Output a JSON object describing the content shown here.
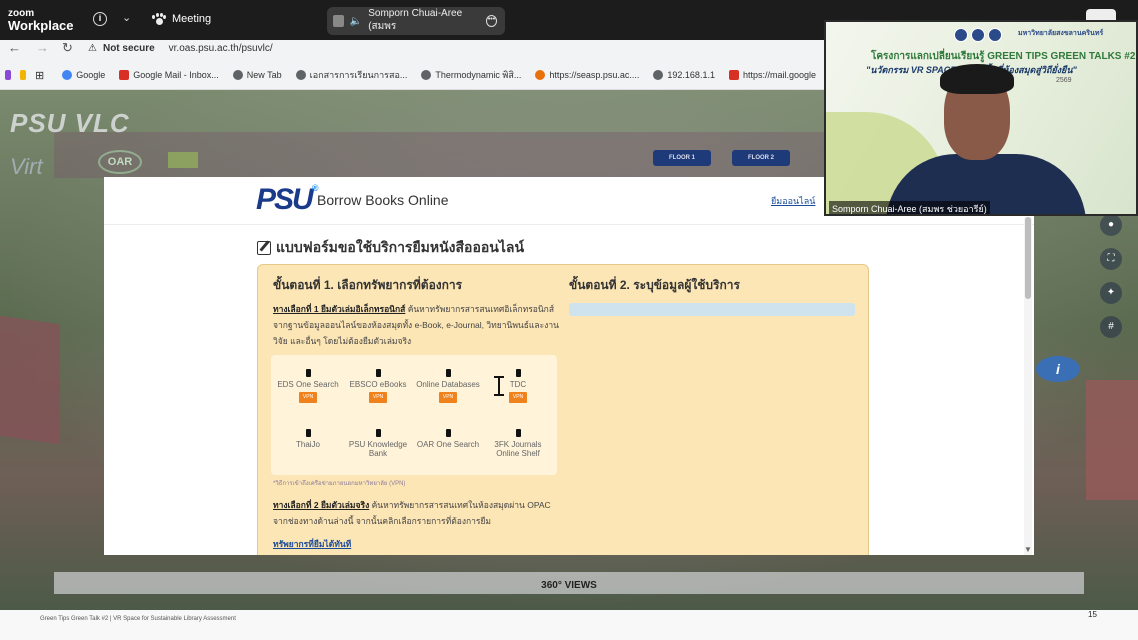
{
  "zoom": {
    "brand_line1": "zoom",
    "brand_line2": "Workplace",
    "meeting_label": "Meeting",
    "speaker": "Somporn Chuai-Aree (สมพร"
  },
  "browser": {
    "security": "Not secure",
    "url": "vr.oas.psu.ac.th/psuvlc/",
    "bookmarks": [
      "Google",
      "Google Mail - Inbox...",
      "New Tab",
      "เอกสารการเรียนการสอ...",
      "Thermodynamic พิสิ...",
      "https://seasp.psu.ac....",
      "192.168.1.1",
      "https://mail.google"
    ]
  },
  "vr": {
    "title": "PSU VLC",
    "subtitle": "Virt",
    "oar_label": "OAR",
    "floors": [
      "FLOOR 1",
      "FLOOR 2"
    ],
    "views_label": "360° VIEWS"
  },
  "modal": {
    "logo": "PSU",
    "logo_mark": "®",
    "title": "Borrow Books Online",
    "header_link": "ยืมออนไลน์",
    "form_title": "แบบฟอร์มขอใช้บริการยืมหนังสือออนไลน์",
    "step1": "ขั้นตอนที่ 1. เลือกทรัพยากรที่ต้องการ",
    "step2": "ขั้นตอนที่ 2. ระบุข้อมูลผู้ใช้บริการ",
    "option1_head": "ทางเลือกที่ 1 ยืมตัวเล่มอิเล็กทรอนิกส์",
    "option1_body": " ค้นหาทรัพยากรสารสนเทศอิเล็กทรอนิกส์จากฐานข้อมูลออนไลน์ของห้องสมุดทั้ง e-Book, e-Journal, วิทยานิพนธ์และงานวิจัย และอื่นๆ โดยไม่ต้องยืมตัวเล่มจริง",
    "resources": [
      {
        "name": "EDS One Search",
        "vpn": "VPN"
      },
      {
        "name": "EBSCO eBooks",
        "vpn": "VPN"
      },
      {
        "name": "Online Databases",
        "vpn": "VPN"
      },
      {
        "name": "TDC",
        "vpn": "VPN"
      },
      {
        "name": "ThaiJo",
        "vpn": ""
      },
      {
        "name": "PSU Knowledge Bank",
        "vpn": ""
      },
      {
        "name": "OAR One Search",
        "vpn": ""
      },
      {
        "name": "3FK Journals Online Shelf",
        "vpn": ""
      }
    ],
    "vpn_note": "*วิธีการเข้าถึงเครือข่ายภายนอกมหาวิทยาลัย (VPN)",
    "option2_head": "ทางเลือกที่ 2 ยืมตัวเล่มจริง",
    "option2_body": " ค้นหาทรัพยากรสารสนเทศในห้องสมุดผ่าน OPAC จากช่องทางด้านล่างนี้ จากนั้นคลิกเลือกรายการที่ต้องการยืม",
    "available_now": "ทรัพยากรที่ยืมได้ทันที"
  },
  "video": {
    "project_line": "โครงการแลกเปลี่ยนเรียนรู้ GREEN TIPS GREEN TALKS #2",
    "topic_line": "\"นวัตกรรม VR SPACE: ...เมินพื้นที่ห้องสมุดสู่วิถียั่งยืน\"",
    "year": "2569",
    "uni": "มหาวิทยาลัยสงขลานครินทร์",
    "name_tag": "Somporn Chuai-Aree (สมพร ช่วยอารีย์)"
  },
  "footer": {
    "text": "Green Tips Green Talk #2  |  VR Space for Sustainable Library Assessment",
    "page": "15"
  }
}
